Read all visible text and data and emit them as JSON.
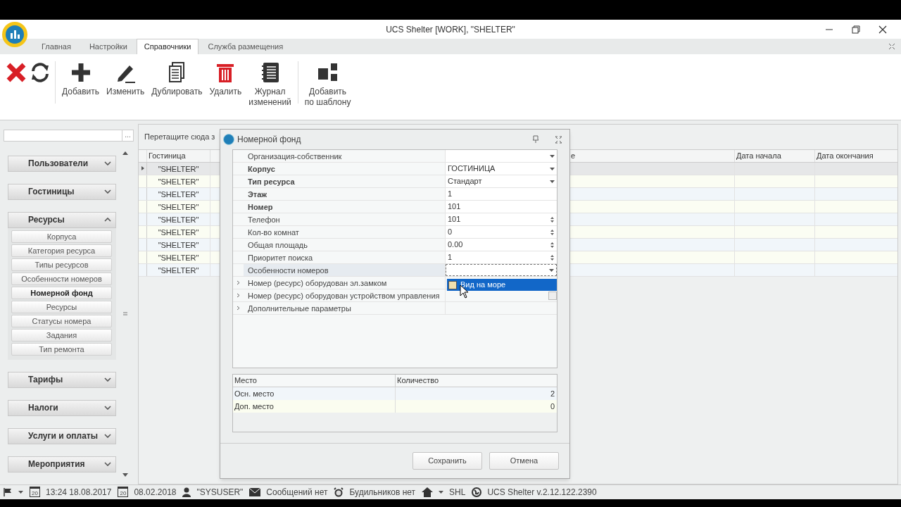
{
  "window": {
    "title": "UCS Shelter [WORK], \"SHELTER\""
  },
  "tabs": [
    {
      "label": "Главная",
      "selected": false
    },
    {
      "label": "Настройки",
      "selected": false
    },
    {
      "label": "Справочники",
      "selected": true
    },
    {
      "label": "Служба размещения",
      "selected": false
    }
  ],
  "toolbar": [
    {
      "kind": "delete"
    },
    {
      "kind": "refresh"
    },
    {
      "kind": "separator"
    },
    {
      "kind": "add",
      "label": "Добавить"
    },
    {
      "kind": "edit",
      "label": "Изменить"
    },
    {
      "kind": "copy",
      "label": "Дублировать"
    },
    {
      "kind": "trash",
      "label": "Удалить"
    },
    {
      "kind": "journal",
      "label": "Журнал\nизменений"
    },
    {
      "kind": "separator"
    },
    {
      "kind": "template",
      "label": "Добавить\nпо шаблону"
    }
  ],
  "sidebar": {
    "search_button": "...",
    "groups": [
      {
        "label": "Пользователи",
        "expanded": false
      },
      {
        "label": "Гостиницы",
        "expanded": false
      },
      {
        "label": "Ресурсы",
        "expanded": true,
        "children": [
          {
            "label": "Корпуса",
            "selected": false
          },
          {
            "label": "Категория ресурса",
            "selected": false
          },
          {
            "label": "Типы ресурсов",
            "selected": false
          },
          {
            "label": "Особенности номеров",
            "selected": false
          },
          {
            "label": "Номерной фонд",
            "selected": true
          },
          {
            "label": "Ресурсы",
            "selected": false
          },
          {
            "label": "Статусы номера",
            "selected": false
          },
          {
            "label": "Задания",
            "selected": false
          },
          {
            "label": "Тип ремонта",
            "selected": false
          }
        ]
      },
      {
        "label": "Тарифы",
        "expanded": false
      },
      {
        "label": "Налоги",
        "expanded": false
      },
      {
        "label": "Услуги и оплаты",
        "expanded": false
      },
      {
        "label": "Мероприятия",
        "expanded": false
      }
    ]
  },
  "grid": {
    "group_panel": "Перетащите сюда з",
    "columns": [
      "Гостиница",
      "е",
      "Дата начала",
      "Дата окончания"
    ],
    "rows": [
      {
        "hotel": "\"SHELTER\"",
        "selected": true
      },
      {
        "hotel": "\"SHELTER\"",
        "selected": false
      },
      {
        "hotel": "\"SHELTER\"",
        "selected": false
      },
      {
        "hotel": "\"SHELTER\"",
        "selected": false
      },
      {
        "hotel": "\"SHELTER\"",
        "selected": false
      },
      {
        "hotel": "\"SHELTER\"",
        "selected": false
      },
      {
        "hotel": "\"SHELTER\"",
        "selected": false
      },
      {
        "hotel": "\"SHELTER\"",
        "selected": false
      },
      {
        "hotel": "\"SHELTER\"",
        "selected": false
      }
    ]
  },
  "dialog": {
    "title": "Номерной фонд",
    "properties": [
      {
        "label": "Организация-собственник",
        "bold": false,
        "kind": "dropdown"
      },
      {
        "label": "Корпус",
        "bold": true,
        "kind": "dropdown",
        "value": "ГОСТИНИЦА"
      },
      {
        "label": "Тип ресурса",
        "bold": true,
        "kind": "dropdown",
        "value": "Стандарт"
      },
      {
        "label": "Этаж",
        "bold": true,
        "kind": "text",
        "value": "1"
      },
      {
        "label": "Номер",
        "bold": true,
        "kind": "text",
        "value": "101"
      },
      {
        "label": "Телефон",
        "bold": false,
        "kind": "spin",
        "value": "101"
      },
      {
        "label": "Кол-во комнат",
        "bold": false,
        "kind": "spin",
        "value": "0"
      },
      {
        "label": "Общая площадь",
        "bold": false,
        "kind": "spin",
        "value": "0.00"
      },
      {
        "label": "Приоритет поиска",
        "bold": false,
        "kind": "spin",
        "value": "1"
      },
      {
        "label": "Особенности номеров",
        "bold": false,
        "kind": "focused"
      },
      {
        "label": "Номер (ресурс) оборудован эл.замком",
        "bold": false,
        "kind": "group"
      },
      {
        "label": "Номер (ресурс) оборудован устройством управления",
        "bold": false,
        "kind": "checkbox",
        "checked": false
      },
      {
        "label": "Дополнительные параметры",
        "bold": false,
        "kind": "group"
      }
    ],
    "popup": {
      "label": "Вид на море",
      "checked": false
    },
    "places": {
      "columns": [
        "Место",
        "Количество"
      ],
      "rows": [
        {
          "place": "Осн. место",
          "count": "2"
        },
        {
          "place": "Доп. место",
          "count": "0"
        }
      ]
    },
    "buttons": [
      "Сохранить",
      "Отмена"
    ]
  },
  "status_bar": [
    {
      "kind": "flag"
    },
    {
      "kind": "calendar",
      "day": "20",
      "text": "13:24 18.08.2017"
    },
    {
      "kind": "calendar",
      "day": "20",
      "text": "08.02.2018"
    },
    {
      "kind": "user",
      "text": "\"SYSUSER\""
    },
    {
      "kind": "mail",
      "text": "Сообщений нет"
    },
    {
      "kind": "alarm",
      "text": "Будильников нет"
    },
    {
      "kind": "home",
      "text": "SHL"
    },
    {
      "kind": "globe",
      "text": "UCS Shelter v.2.12.122.2390"
    }
  ]
}
